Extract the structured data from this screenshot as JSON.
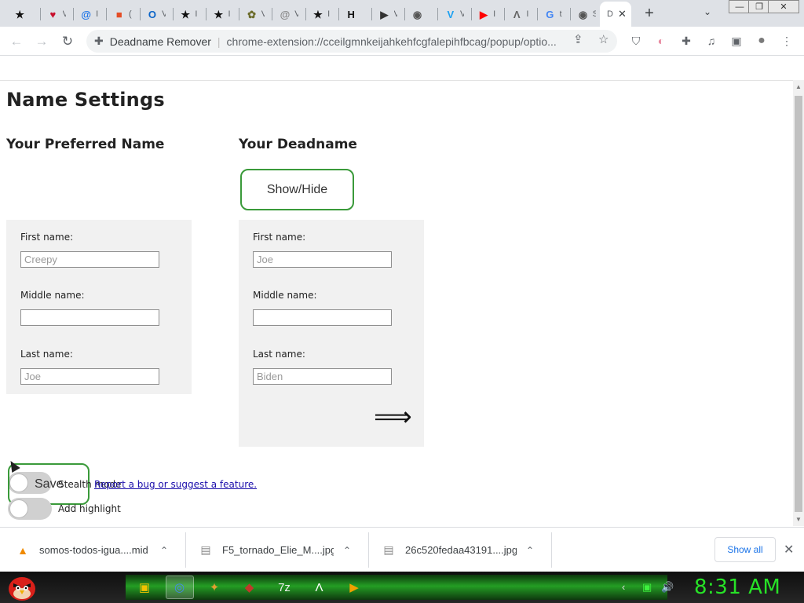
{
  "browser": {
    "tabs": [
      {
        "icon": "★",
        "letter": "",
        "color": "#111111"
      },
      {
        "icon": "♥",
        "letter": "V",
        "color": "#c8102e"
      },
      {
        "icon": "@",
        "letter": "I",
        "color": "#1a73e8"
      },
      {
        "icon": "■",
        "letter": "(",
        "color": "#e44d26"
      },
      {
        "icon": "O",
        "letter": "V",
        "color": "#0a64c8"
      },
      {
        "icon": "★",
        "letter": "I",
        "color": "#111111"
      },
      {
        "icon": "★",
        "letter": "I",
        "color": "#111111"
      },
      {
        "icon": "✿",
        "letter": "V",
        "color": "#6b6b2a"
      },
      {
        "icon": "@",
        "letter": "V",
        "color": "#888888"
      },
      {
        "icon": "★",
        "letter": "I",
        "color": "#111111"
      },
      {
        "icon": "H",
        "letter": "",
        "color": "#111111"
      },
      {
        "icon": "▶",
        "letter": "V",
        "color": "#333333"
      },
      {
        "icon": "◉",
        "letter": "",
        "color": "#555555"
      },
      {
        "icon": "V",
        "letter": "V",
        "color": "#1ea1f1"
      },
      {
        "icon": "▶",
        "letter": "I",
        "color": "#ff0000"
      },
      {
        "icon": "Λ",
        "letter": "I",
        "color": "#666666"
      },
      {
        "icon": "G",
        "letter": "t",
        "color": "#4285f4"
      },
      {
        "icon": "◉",
        "letter": "S",
        "color": "#555555"
      }
    ],
    "active_tab_letter": "D",
    "active_tab_close": "✕",
    "new_tab": "+",
    "tab_search": "⌄",
    "window_controls": {
      "minimize": "—",
      "restore": "❐",
      "close": "✕"
    },
    "nav": {
      "back": "←",
      "forward": "→",
      "reload": "↻"
    },
    "omnibox": {
      "site_name": "Deadname Remover",
      "separator": "|",
      "url": "chrome-extension://cceilgmnkeijahkehfcgfalepihfbcag/popup/optio..."
    },
    "toolbar_icons": {
      "share": "⇪",
      "bookmark": "☆",
      "ublock": "⛉",
      "flag": "◐",
      "extensions": "✚",
      "media": "♫",
      "sidepanel": "▣",
      "profile": "●",
      "menu": "⋮"
    }
  },
  "page": {
    "title": "Name Settings",
    "preferred": {
      "heading": "Your Preferred Name",
      "first_label": "First name:",
      "first_placeholder": "Creepy",
      "middle_label": "Middle name:",
      "middle_placeholder": "",
      "last_label": "Last name:",
      "last_placeholder": "Joe"
    },
    "deadname": {
      "heading": "Your Deadname",
      "show_hide": "Show/Hide",
      "first_label": "First name:",
      "first_placeholder": "Joe",
      "middle_label": "Middle name:",
      "middle_placeholder": "",
      "last_label": "Last name:",
      "last_placeholder": "Biden",
      "arrow": "⟹"
    },
    "save": "Save",
    "stealth_mode": "Stealth mode",
    "report_link": "Report a bug or suggest a feature.",
    "add_highlight": "Add highlight"
  },
  "downloads": {
    "items": [
      {
        "name": "somos-todos-igua....mid",
        "icon": "▲",
        "color": "#f08a00"
      },
      {
        "name": "F5_tornado_Elie_M....jpg",
        "icon": "▤",
        "color": "#888888"
      },
      {
        "name": "26c520fedaa43191....jpg",
        "icon": "▤",
        "color": "#888888"
      }
    ],
    "chevron": "⌃",
    "show_all": "Show all",
    "close": "✕"
  },
  "taskbar": {
    "apps": [
      "▣",
      "◎",
      "✦",
      "◆",
      "7z",
      "Λ",
      "▶"
    ],
    "active_index": 1,
    "tray": [
      "‹",
      "▣",
      "🔊"
    ],
    "clock": "8:31 AM"
  }
}
